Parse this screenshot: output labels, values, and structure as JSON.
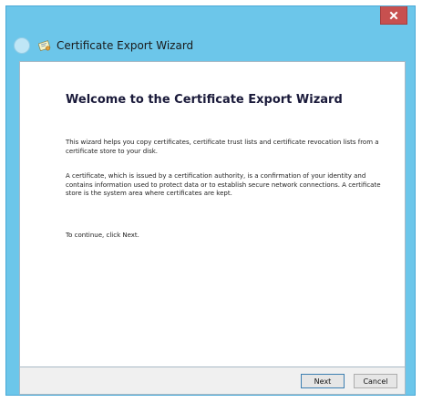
{
  "window": {
    "title": "Certificate Export Wizard",
    "accent_color": "#6cc6ea",
    "close_color": "#c7504f"
  },
  "icons": {
    "close": "close-icon",
    "back": "back-arrow-icon",
    "app": "certificate-icon"
  },
  "main": {
    "heading": "Welcome to the Certificate Export Wizard",
    "paragraph1": "This wizard helps you copy certificates, certificate trust lists and certificate revocation lists from a certificate store to your disk.",
    "paragraph2": "A certificate, which is issued by a certification authority, is a confirmation of your identity and contains information used to protect data or to establish secure network connections. A certificate store is the system area where certificates are kept.",
    "paragraph3": "To continue, click Next."
  },
  "footer": {
    "next_label": "Next",
    "cancel_label": "Cancel"
  }
}
